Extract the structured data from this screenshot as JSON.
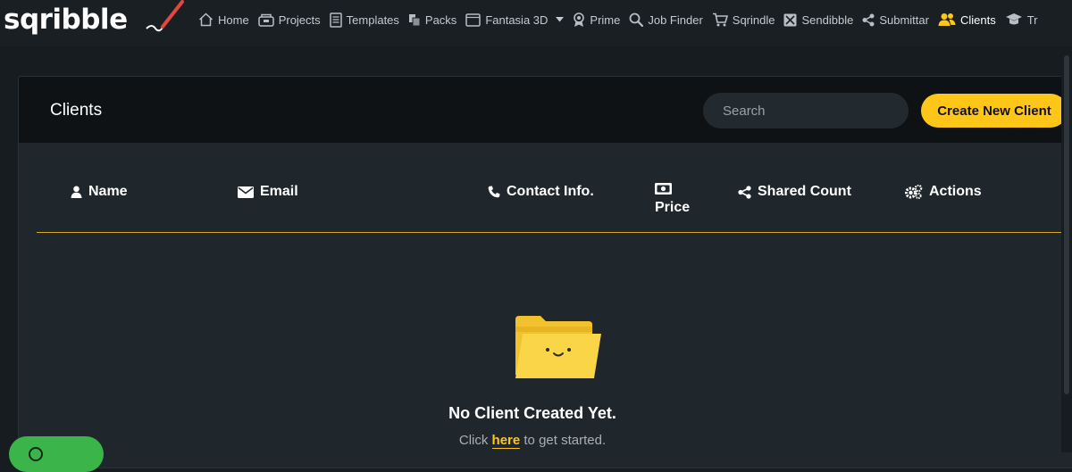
{
  "brand": {
    "logo_text": "sqribble"
  },
  "nav": {
    "items": [
      {
        "label": "Home",
        "icon": "home-icon"
      },
      {
        "label": "Projects",
        "icon": "projects-icon"
      },
      {
        "label": "Templates",
        "icon": "templates-icon"
      },
      {
        "label": "Packs",
        "icon": "packs-icon"
      },
      {
        "label": "Fantasia 3D",
        "icon": "fantasia-icon"
      },
      {
        "label": "Prime",
        "icon": "prime-icon"
      },
      {
        "label": "Job Finder",
        "icon": "search-icon"
      },
      {
        "label": "Sqrindle",
        "icon": "cart-icon"
      },
      {
        "label": "Sendibble",
        "icon": "mail-icon"
      },
      {
        "label": "Submittar",
        "icon": "share-icon"
      },
      {
        "label": "Clients",
        "icon": "clients-icon",
        "active": true
      },
      {
        "label": "Tr",
        "icon": "training-icon"
      }
    ]
  },
  "page": {
    "title": "Clients",
    "search_placeholder": "Search",
    "create_button": "Create New Client"
  },
  "table": {
    "columns": {
      "name": "Name",
      "email": "Email",
      "contact": "Contact Info.",
      "price": "Price",
      "shared": "Shared Count",
      "actions": "Actions"
    }
  },
  "empty_state": {
    "title": "No Client Created Yet.",
    "sub_prefix": "Click",
    "sub_link": "here",
    "sub_suffix": "to get started."
  },
  "colors": {
    "accent": "#ffc61a",
    "background": "#171c20",
    "card": "#1f272c",
    "header": "#0f1214",
    "help_bubble": "#3bb54a"
  }
}
